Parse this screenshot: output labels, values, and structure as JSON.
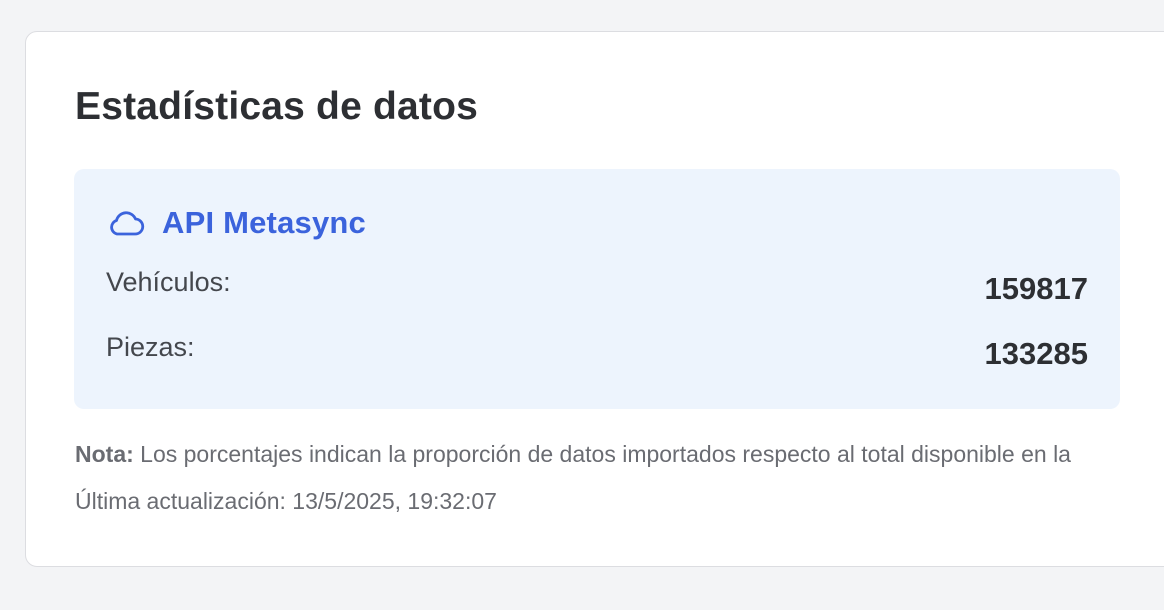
{
  "card": {
    "title": "Estadísticas de datos"
  },
  "source": {
    "icon": "cloud-icon",
    "name": "API Metasync",
    "accent_color": "#3b63dc",
    "stats": [
      {
        "label": "Vehículos:",
        "value": "159817"
      },
      {
        "label": "Piezas:",
        "value": "133285"
      }
    ]
  },
  "note": {
    "prefix": "Nota:",
    "text": " Los porcentajes indican la proporción de datos importados respecto al total disponible en la"
  },
  "last_updated": {
    "label": "Última actualización:",
    "value": " 13/5/2025, 19:32:07"
  }
}
